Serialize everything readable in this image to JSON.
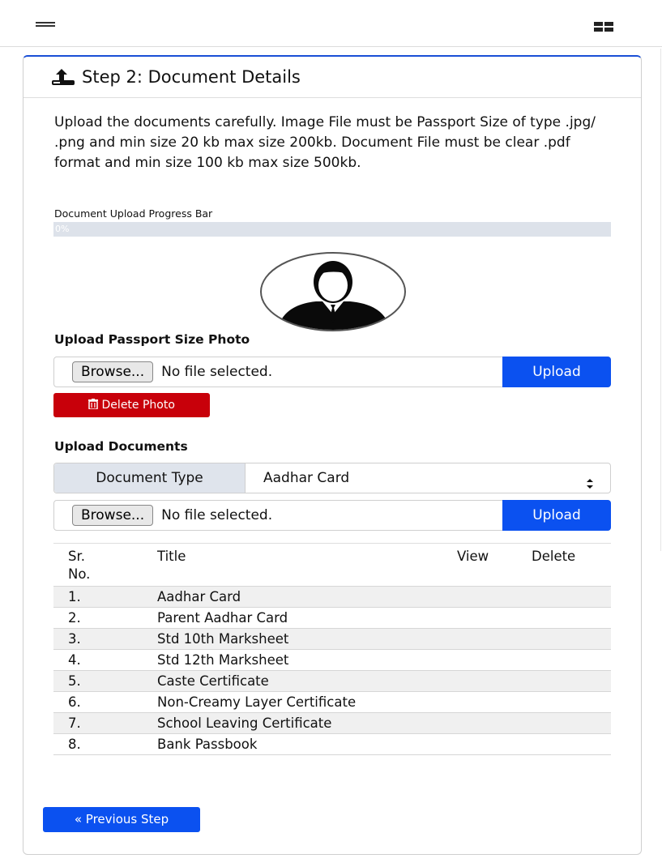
{
  "topbar": {
    "menu_icon": "hamburger-icon",
    "apps_icon": "grid-icon"
  },
  "card": {
    "header_icon": "upload-icon",
    "title": "Step 2: Document Details",
    "intro": "Upload the documents carefully. Image File must be Passport Size of type .jpg/ .png and min size 20 kb max size 200kb. Document File must be clear .pdf format and min size 100 kb max size 500kb.",
    "progress": {
      "label": "Document Upload Progress Bar",
      "text": "0%",
      "value": 0
    },
    "photo": {
      "avatar_icon": "user-avatar-icon",
      "section_label": "Upload Passport Size Photo",
      "browse_label": "Browse...",
      "file_status": "No file selected.",
      "upload_label": "Upload",
      "delete_label": "Delete Photo",
      "delete_icon": "trash-icon"
    },
    "documents": {
      "section_label": "Upload Documents",
      "type_label": "Document Type",
      "type_value": "Aadhar Card",
      "browse_label": "Browse...",
      "file_status": "No file selected.",
      "upload_label": "Upload"
    },
    "table": {
      "headers": {
        "sr": "Sr.\nNo.",
        "title": "Title",
        "view": "View",
        "delete": "Delete"
      },
      "rows": [
        {
          "sr": "1.",
          "title": "Aadhar Card"
        },
        {
          "sr": "2.",
          "title": "Parent Aadhar Card"
        },
        {
          "sr": "3.",
          "title": "Std 10th Marksheet"
        },
        {
          "sr": "4.",
          "title": "Std 12th Marksheet"
        },
        {
          "sr": "5.",
          "title": "Caste Certificate"
        },
        {
          "sr": "6.",
          "title": "Non-Creamy Layer Certificate"
        },
        {
          "sr": "7.",
          "title": "School Leaving Certificate"
        },
        {
          "sr": "8.",
          "title": "Bank Passbook"
        }
      ]
    },
    "prev_label": "« Previous Step"
  },
  "colors": {
    "primary": "#0b51f0",
    "danger": "#c8000a",
    "progress_track": "#dde2ea",
    "addon_bg": "#dfe4ec",
    "card_accent": "#1a4fd6"
  }
}
